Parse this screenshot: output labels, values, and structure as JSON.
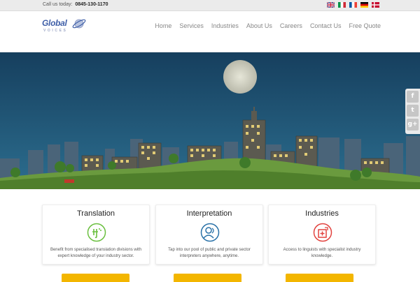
{
  "topbar": {
    "call_label": "Call us today:",
    "phone": "0845-130-1170",
    "flags": [
      "uk-flag",
      "italy-flag",
      "france-flag",
      "germany-flag",
      "denmark-flag"
    ]
  },
  "logo": {
    "word": "Global",
    "sub": "VOICES"
  },
  "nav": {
    "items": [
      "Home",
      "Services",
      "Industries",
      "About Us",
      "Careers",
      "Contact Us",
      "Free Quote"
    ]
  },
  "social": [
    "facebook-icon",
    "twitter-icon",
    "google-plus-icon"
  ],
  "social_labels": {
    "facebook": "f",
    "twitter": "t",
    "google": "g+"
  },
  "cards": [
    {
      "title": "Translation",
      "icon": "translation-icon",
      "text": "Benefit from specialised translation divisions with expert knowledge of your industry sector."
    },
    {
      "title": "Interpretation",
      "icon": "interpretation-icon",
      "text": "Tap into our pool of public and private sector interpreters anywhere, anytime."
    },
    {
      "title": "Industries",
      "icon": "industries-icon",
      "text": "Access to linguists with specialist industry knowledge."
    }
  ],
  "colors": {
    "accent_green": "#6abf3f",
    "accent_blue": "#2a72a8",
    "accent_red": "#e2433f",
    "button_yellow": "#f3b600",
    "sky": "#1e4b6c"
  }
}
